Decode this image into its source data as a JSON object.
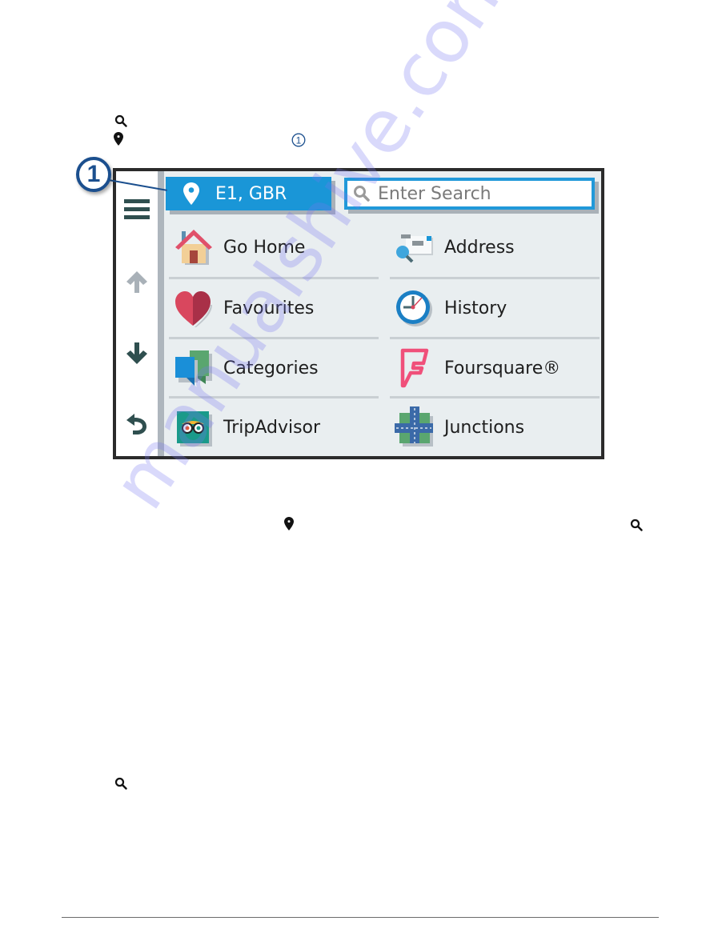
{
  "document": {
    "inline_icons": [
      {
        "name": "search-icon",
        "context": "step text line 1"
      },
      {
        "name": "location-pin-icon",
        "context": "step text line 2"
      },
      {
        "name": "callout-1-marker",
        "text": "①"
      },
      {
        "name": "location-pin-icon",
        "context": "paragraph below figure"
      },
      {
        "name": "search-icon",
        "context": "paragraph below figure, right"
      },
      {
        "name": "search-icon",
        "context": "lower step text"
      }
    ],
    "callout_marker_text": "①"
  },
  "figure": {
    "callout_label": "1",
    "location_button": {
      "label": "E1, GBR",
      "icon": "location-pin-icon"
    },
    "search_field": {
      "placeholder": "Enter Search",
      "value": "",
      "icon": "search-icon"
    },
    "left_rail": [
      {
        "name": "menu-icon",
        "state": "active"
      },
      {
        "name": "arrow-up-icon",
        "state": "disabled"
      },
      {
        "name": "arrow-down-icon",
        "state": "active"
      },
      {
        "name": "back-icon",
        "state": "active"
      }
    ],
    "categories": [
      {
        "label": "Go Home",
        "icon": "home-icon"
      },
      {
        "label": "Address",
        "icon": "address-icon"
      },
      {
        "label": "Favourites",
        "icon": "heart-icon"
      },
      {
        "label": "History",
        "icon": "clock-icon"
      },
      {
        "label": "Categories",
        "icon": "categories-icon"
      },
      {
        "label": "Foursquare®",
        "icon": "foursquare-icon"
      },
      {
        "label": "TripAdvisor",
        "icon": "tripadvisor-icon"
      },
      {
        "label": "Junctions",
        "icon": "junction-icon"
      }
    ],
    "colors": {
      "accent_blue": "#1a96d7",
      "callout_blue": "#1b4f8e",
      "screen_bg": "#e9eef0",
      "rail_icon": "#2f4f4f",
      "rail_icon_disabled": "#a9b1b8"
    }
  },
  "watermark": {
    "text": "manualshive.com"
  }
}
